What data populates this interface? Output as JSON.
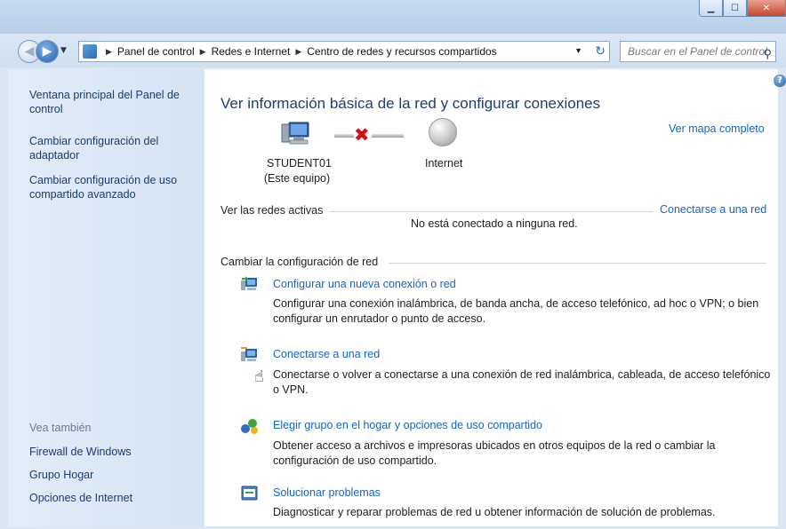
{
  "window": {
    "minimize_icon": "minimize-icon",
    "maximize_icon": "maximize-icon",
    "close_icon": "close-icon"
  },
  "address": {
    "crumbs": [
      "Panel de control",
      "Redes e Internet",
      "Centro de redes y recursos compartidos"
    ],
    "search_placeholder": "Buscar en el Panel de control"
  },
  "sidebar": {
    "links": [
      "Ventana principal del Panel de control",
      "Cambiar configuración del adaptador",
      "Cambiar configuración de uso compartido avanzado"
    ],
    "see_also_label": "Vea también",
    "see_also": [
      "Firewall de Windows",
      "Grupo Hogar",
      "Opciones de Internet"
    ]
  },
  "main": {
    "title": "Ver información básica de la red y configurar conexiones",
    "full_map_link": "Ver mapa completo",
    "computer_name": "STUDENT01",
    "computer_sub": "(Este equipo)",
    "internet_label": "Internet",
    "active_networks_label": "Ver las redes activas",
    "connect_link": "Conectarse a una red",
    "not_connected": "No está conectado a ninguna red.",
    "change_config_label": "Cambiar la configuración de red",
    "tasks": [
      {
        "title": "Configurar una nueva conexión o red",
        "desc": "Configurar una conexión inalámbrica, de banda ancha, de acceso telefónico, ad hoc o VPN; o bien configurar un enrutador o punto de acceso."
      },
      {
        "title": "Conectarse a una red",
        "desc": "Conectarse o volver a conectarse a una conexión de red inalámbrica, cableada, de acceso telefónico o VPN."
      },
      {
        "title": "Elegir grupo en el hogar y opciones de uso compartido",
        "desc": "Obtener acceso a archivos e impresoras ubicados en otros equipos de la red o cambiar la configuración de uso compartido."
      },
      {
        "title": "Solucionar problemas",
        "desc": "Diagnosticar y reparar problemas de red u obtener información de solución de problemas."
      }
    ]
  }
}
